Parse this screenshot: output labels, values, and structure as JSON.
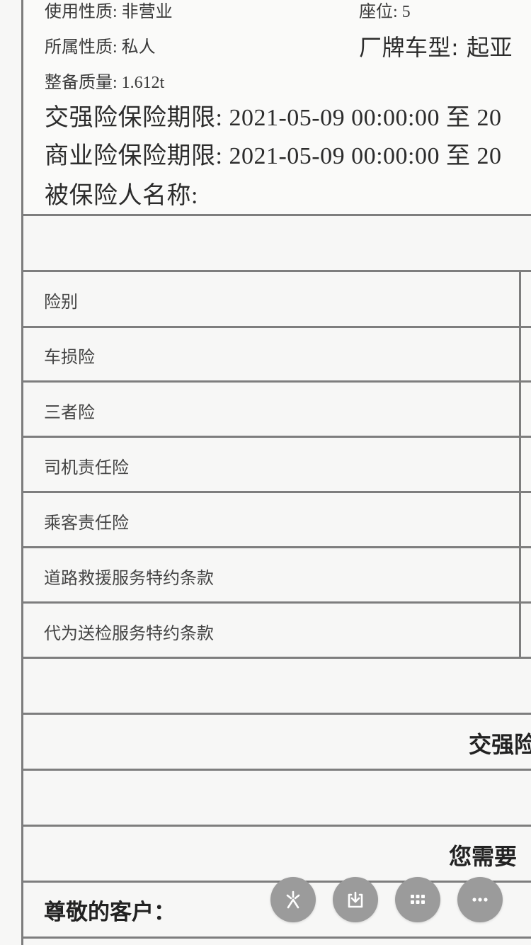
{
  "document": {
    "info": {
      "usage_nature": "使用性质: 非营业",
      "seats": "座位: 5",
      "ownership": "所属性质: 私人",
      "brand_model": "厂牌车型: 起亚",
      "curb_weight": "整备质量: 1.612t",
      "compulsory_period": "交强险保险期限: 2021-05-09 00:00:00 至 20",
      "commercial_period": "商业险保险期限: 2021-05-09 00:00:00 至 20",
      "insured_name": "被保险人名称:"
    },
    "table": {
      "header": "险别",
      "rows": [
        "车损险",
        "三者险",
        "司机责任险",
        "乘客责任险",
        "道路救援服务特约条款",
        "代为送检服务特约条款"
      ]
    },
    "compulsory_label": "交强险",
    "need_label": "您需要",
    "greeting": "尊敬的客户："
  },
  "toolbar": {
    "buttons": [
      {
        "icon": "spark-icon"
      },
      {
        "icon": "download-icon"
      },
      {
        "icon": "grid-icon"
      },
      {
        "icon": "more-icon"
      }
    ]
  },
  "colors": {
    "toolbar_button": "#9b9b9b",
    "rule": "#7e7e7e"
  }
}
